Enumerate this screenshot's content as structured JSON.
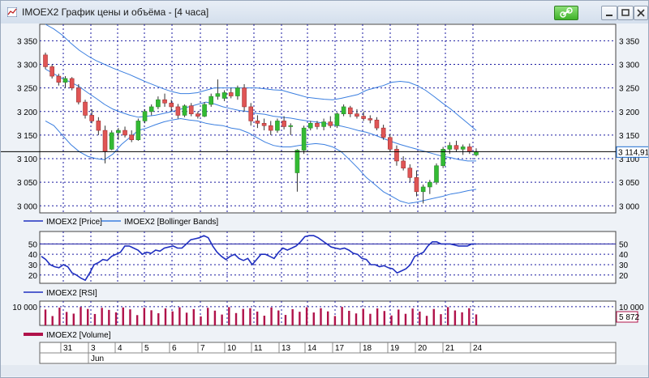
{
  "window": {
    "title": "IMOEX2 График цены и объёма - [4 часа]",
    "title_color": "#1a1a1a"
  },
  "colors": {
    "up_candle": "#33bb33",
    "down_candle": "#e05555",
    "grid": "#1a1aa0",
    "bollinger": "#3b7fe0",
    "rsi_line": "#1f2fc0",
    "volume": "#b0124a",
    "background": "#ffffff"
  },
  "chart_data": [
    {
      "id": "price",
      "type": "candlestick",
      "y_ticks": [
        "3 350",
        "3 300",
        "3 250",
        "3 200",
        "3 150",
        "3 100",
        "3 050",
        "3 000"
      ],
      "y_tick_values": [
        3350,
        3300,
        3250,
        3200,
        3150,
        3100,
        3050,
        3000
      ],
      "ylim": [
        2985,
        3385
      ],
      "last_price_label": "3 114,91",
      "last_price": 3114.91,
      "legend": [
        "IMOEX2 [Price]",
        "IMOEX2 [Bollinger Bands]"
      ],
      "candles": [
        {
          "o": 3320,
          "h": 3325,
          "l": 3290,
          "c": 3295
        },
        {
          "o": 3295,
          "h": 3300,
          "l": 3270,
          "c": 3275
        },
        {
          "o": 3275,
          "h": 3280,
          "l": 3255,
          "c": 3262
        },
        {
          "o": 3262,
          "h": 3275,
          "l": 3250,
          "c": 3270
        },
        {
          "o": 3270,
          "h": 3273,
          "l": 3245,
          "c": 3250
        },
        {
          "o": 3250,
          "h": 3258,
          "l": 3215,
          "c": 3220
        },
        {
          "o": 3220,
          "h": 3225,
          "l": 3185,
          "c": 3192
        },
        {
          "o": 3192,
          "h": 3205,
          "l": 3175,
          "c": 3180
        },
        {
          "o": 3180,
          "h": 3188,
          "l": 3150,
          "c": 3160
        },
        {
          "o": 3160,
          "h": 3170,
          "l": 3090,
          "c": 3115
        },
        {
          "o": 3120,
          "h": 3160,
          "l": 3118,
          "c": 3155
        },
        {
          "o": 3155,
          "h": 3165,
          "l": 3140,
          "c": 3160
        },
        {
          "o": 3160,
          "h": 3168,
          "l": 3145,
          "c": 3150
        },
        {
          "o": 3150,
          "h": 3160,
          "l": 3135,
          "c": 3140
        },
        {
          "o": 3140,
          "h": 3185,
          "l": 3138,
          "c": 3180
        },
        {
          "o": 3180,
          "h": 3205,
          "l": 3175,
          "c": 3200
        },
        {
          "o": 3200,
          "h": 3215,
          "l": 3192,
          "c": 3210
        },
        {
          "o": 3210,
          "h": 3232,
          "l": 3205,
          "c": 3225
        },
        {
          "o": 3225,
          "h": 3238,
          "l": 3210,
          "c": 3218
        },
        {
          "o": 3218,
          "h": 3225,
          "l": 3200,
          "c": 3210
        },
        {
          "o": 3210,
          "h": 3216,
          "l": 3185,
          "c": 3192
        },
        {
          "o": 3192,
          "h": 3215,
          "l": 3188,
          "c": 3212
        },
        {
          "o": 3212,
          "h": 3218,
          "l": 3190,
          "c": 3195
        },
        {
          "o": 3195,
          "h": 3200,
          "l": 3185,
          "c": 3190
        },
        {
          "o": 3190,
          "h": 3220,
          "l": 3188,
          "c": 3215
        },
        {
          "o": 3215,
          "h": 3238,
          "l": 3210,
          "c": 3232
        },
        {
          "o": 3232,
          "h": 3268,
          "l": 3225,
          "c": 3238
        },
        {
          "o": 3228,
          "h": 3245,
          "l": 3222,
          "c": 3240
        },
        {
          "o": 3240,
          "h": 3250,
          "l": 3228,
          "c": 3233
        },
        {
          "o": 3233,
          "h": 3255,
          "l": 3225,
          "c": 3250
        },
        {
          "o": 3250,
          "h": 3258,
          "l": 3200,
          "c": 3210
        },
        {
          "o": 3210,
          "h": 3218,
          "l": 3170,
          "c": 3180
        },
        {
          "o": 3180,
          "h": 3192,
          "l": 3165,
          "c": 3175
        },
        {
          "o": 3175,
          "h": 3185,
          "l": 3160,
          "c": 3170
        },
        {
          "o": 3170,
          "h": 3180,
          "l": 3150,
          "c": 3160
        },
        {
          "o": 3160,
          "h": 3185,
          "l": 3155,
          "c": 3180
        },
        {
          "o": 3180,
          "h": 3190,
          "l": 3162,
          "c": 3168
        },
        {
          "o": 3168,
          "h": 3175,
          "l": 3150,
          "c": 3170
        },
        {
          "o": 3070,
          "h": 3120,
          "l": 3030,
          "c": 3118
        },
        {
          "o": 3118,
          "h": 3170,
          "l": 3110,
          "c": 3165
        },
        {
          "o": 3165,
          "h": 3180,
          "l": 3160,
          "c": 3175
        },
        {
          "o": 3175,
          "h": 3180,
          "l": 3162,
          "c": 3168
        },
        {
          "o": 3168,
          "h": 3185,
          "l": 3160,
          "c": 3178
        },
        {
          "o": 3178,
          "h": 3190,
          "l": 3165,
          "c": 3170
        },
        {
          "o": 3170,
          "h": 3198,
          "l": 3165,
          "c": 3195
        },
        {
          "o": 3195,
          "h": 3215,
          "l": 3190,
          "c": 3210
        },
        {
          "o": 3208,
          "h": 3212,
          "l": 3188,
          "c": 3195
        },
        {
          "o": 3195,
          "h": 3205,
          "l": 3185,
          "c": 3190
        },
        {
          "o": 3190,
          "h": 3200,
          "l": 3180,
          "c": 3185
        },
        {
          "o": 3185,
          "h": 3192,
          "l": 3175,
          "c": 3182
        },
        {
          "o": 3182,
          "h": 3188,
          "l": 3160,
          "c": 3165
        },
        {
          "o": 3165,
          "h": 3172,
          "l": 3140,
          "c": 3145
        },
        {
          "o": 3145,
          "h": 3152,
          "l": 3115,
          "c": 3120
        },
        {
          "o": 3120,
          "h": 3128,
          "l": 3085,
          "c": 3095
        },
        {
          "o": 3095,
          "h": 3105,
          "l": 3075,
          "c": 3080
        },
        {
          "o": 3080,
          "h": 3088,
          "l": 3050,
          "c": 3060
        },
        {
          "o": 3060,
          "h": 3075,
          "l": 3020,
          "c": 3030
        },
        {
          "o": 3030,
          "h": 3045,
          "l": 3005,
          "c": 3040
        },
        {
          "o": 3040,
          "h": 3055,
          "l": 3025,
          "c": 3050
        },
        {
          "o": 3050,
          "h": 3090,
          "l": 3045,
          "c": 3085
        },
        {
          "o": 3085,
          "h": 3125,
          "l": 3080,
          "c": 3120
        },
        {
          "o": 3120,
          "h": 3135,
          "l": 3110,
          "c": 3128
        },
        {
          "o": 3128,
          "h": 3138,
          "l": 3115,
          "c": 3120
        },
        {
          "o": 3120,
          "h": 3130,
          "l": 3108,
          "c": 3125
        },
        {
          "o": 3125,
          "h": 3132,
          "l": 3110,
          "c": 3115
        },
        {
          "o": 3108,
          "h": 3122,
          "l": 3105,
          "c": 3115
        }
      ],
      "bollinger_upper": [
        3385,
        3375,
        3362,
        3345,
        3330,
        3318,
        3308,
        3300,
        3292,
        3285,
        3278,
        3270,
        3262,
        3255,
        3248,
        3242,
        3238,
        3238,
        3240,
        3245,
        3250,
        3250,
        3250,
        3250,
        3250,
        3250,
        3248,
        3246,
        3245,
        3240,
        3235,
        3230,
        3228,
        3226,
        3225,
        3228,
        3232,
        3236,
        3245,
        3250,
        3255,
        3262,
        3264,
        3262,
        3255,
        3245,
        3232,
        3218,
        3205,
        3190,
        3175,
        3160
      ],
      "bollinger_middle": [
        3290,
        3280,
        3270,
        3262,
        3253,
        3240,
        3228,
        3215,
        3205,
        3198,
        3192,
        3188,
        3190,
        3192,
        3196,
        3200,
        3205,
        3210,
        3215,
        3220,
        3216,
        3210,
        3206,
        3202,
        3200,
        3196,
        3194,
        3190,
        3188,
        3186,
        3183,
        3180,
        3178,
        3175,
        3172,
        3169,
        3165,
        3160,
        3156,
        3150,
        3143,
        3136,
        3130,
        3125,
        3120,
        3115,
        3110,
        3105,
        3102,
        3098,
        3095,
        3095
      ],
      "bollinger_lower": [
        3180,
        3170,
        3150,
        3130,
        3115,
        3105,
        3100,
        3098,
        3110,
        3130,
        3145,
        3160,
        3165,
        3172,
        3178,
        3182,
        3185,
        3182,
        3180,
        3175,
        3172,
        3170,
        3165,
        3162,
        3155,
        3145,
        3135,
        3128,
        3125,
        3125,
        3128,
        3130,
        3132,
        3130,
        3125,
        3115,
        3098,
        3080,
        3060,
        3045,
        3030,
        3020,
        3010,
        3005,
        3008,
        3012,
        3016,
        3020,
        3025,
        3028,
        3032,
        3035
      ]
    },
    {
      "id": "rsi",
      "type": "line",
      "y_ticks": [
        "50",
        "40",
        "30",
        "20"
      ],
      "y_tick_values": [
        50,
        40,
        30,
        20
      ],
      "ylim": [
        12,
        62
      ],
      "level": 50,
      "legend": [
        "IMOEX2 [RSI]"
      ],
      "values": [
        38,
        35,
        30,
        28,
        27,
        30,
        28,
        22,
        20,
        17,
        15,
        22,
        30,
        32,
        35,
        34,
        38,
        40,
        42,
        48,
        48,
        46,
        44,
        40,
        42,
        41,
        44,
        43,
        46,
        47,
        48,
        46,
        46,
        50,
        54,
        55,
        56,
        58,
        56,
        48,
        42,
        38,
        35,
        38,
        40,
        36,
        34,
        36,
        30,
        35,
        40,
        40,
        38,
        36,
        42,
        46,
        44,
        46,
        48,
        52,
        57,
        58,
        58,
        56,
        53,
        50,
        47,
        46,
        45,
        46,
        44,
        41,
        40,
        36,
        35,
        30,
        30,
        28,
        29,
        27,
        26,
        22,
        24,
        26,
        30,
        38,
        40,
        42,
        48,
        52,
        52,
        50,
        50,
        50,
        49,
        48,
        48,
        48,
        50,
        50
      ]
    },
    {
      "id": "volume",
      "type": "bar",
      "y_ticks": [
        "10 000"
      ],
      "y_tick_values": [
        10000
      ],
      "ylim": [
        0,
        13000
      ],
      "last_value_label": "5 872",
      "last_value": 5872,
      "legend": [
        "IMOEX2 [Volume]"
      ],
      "values": [
        8500,
        5000,
        9500,
        7200,
        6300,
        9800,
        8800,
        6100,
        9400,
        8300,
        7000,
        9600,
        8600,
        5500,
        9400,
        8100,
        6500,
        9100,
        7500,
        9700,
        6800,
        8700,
        4800,
        9400,
        7900,
        5800,
        9800,
        6600,
        8800,
        9200,
        7400,
        5200,
        9600,
        8000,
        5600,
        8700,
        7300,
        9700,
        6900,
        9200,
        7500,
        5000,
        9900,
        7800,
        6400,
        8900,
        6200,
        9100,
        7700,
        5300,
        8500,
        6200,
        9000,
        7400,
        5100,
        8800,
        6000,
        9800,
        8000,
        7000,
        9200,
        5872
      ]
    }
  ],
  "time_axis": {
    "days": [
      "31",
      "3",
      "4",
      "5",
      "6",
      "7",
      "10",
      "11",
      "13",
      "14",
      "17",
      "18",
      "19",
      "20",
      "21",
      "24"
    ],
    "month_label": "Jun"
  }
}
